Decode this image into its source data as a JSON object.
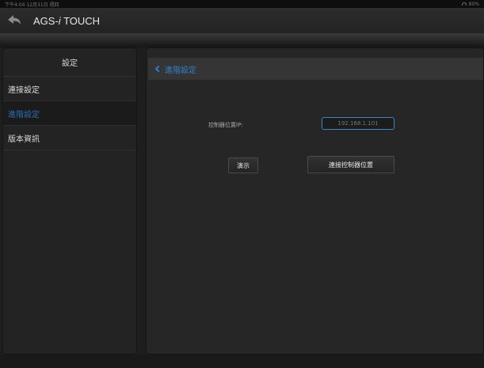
{
  "status_bar": {
    "time": "下午4:04 12月31日 週四",
    "battery": "80%"
  },
  "header": {
    "app_name": "AGS-",
    "app_name_italic": "i",
    "app_name_suffix": " TOUCH"
  },
  "sidebar": {
    "title": "設定",
    "items": [
      {
        "label": "連接設定",
        "active": false
      },
      {
        "label": "進階設定",
        "active": true
      },
      {
        "label": "版本資訊",
        "active": false
      }
    ]
  },
  "main": {
    "nav_back_label": "進階設定",
    "ip_label": "控制器位置IP:",
    "ip_placeholder": "192.168.1.101",
    "demo_label": "演示",
    "connect_label": "連接控制器位置"
  },
  "colors": {
    "accent": "#2f7fd0",
    "background": "#1e1e1e"
  }
}
